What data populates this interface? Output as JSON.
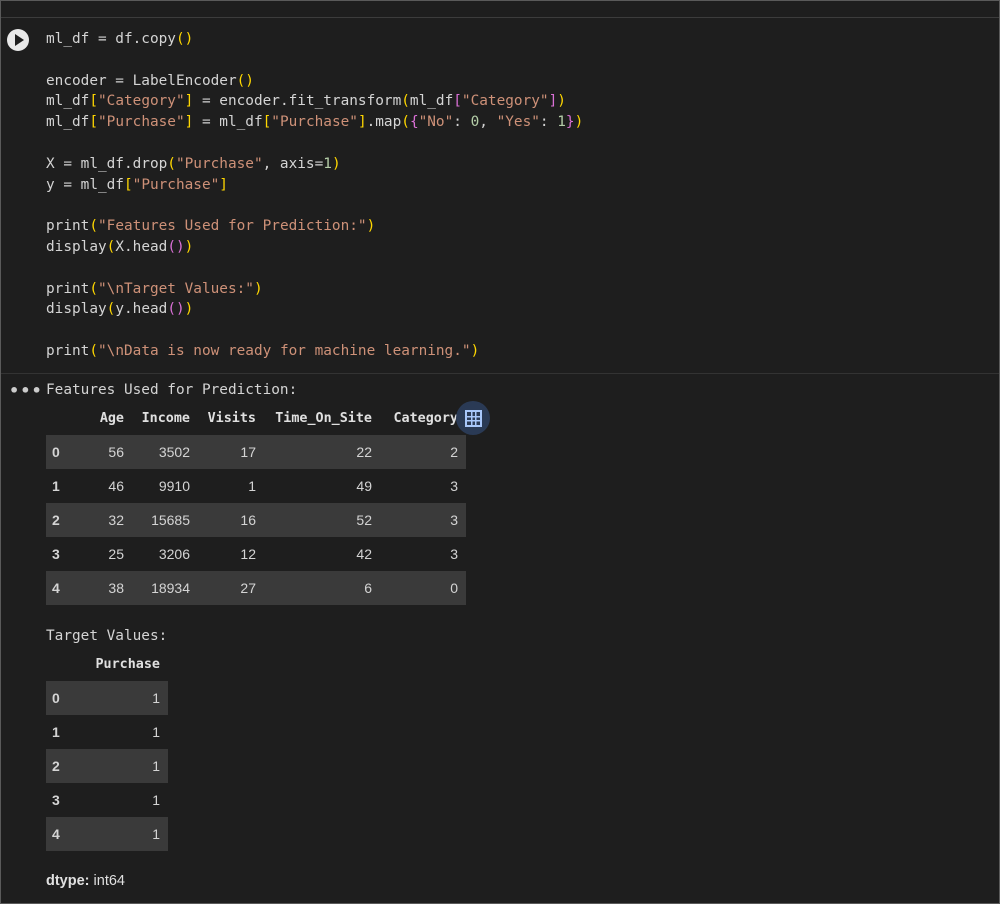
{
  "code_lines": [
    "ml_df = df.copy()",
    "",
    "encoder = LabelEncoder()",
    "ml_df[\"Category\"] = encoder.fit_transform(ml_df[\"Category\"])",
    "ml_df[\"Purchase\"] = ml_df[\"Purchase\"].map({\"No\": 0, \"Yes\": 1})",
    "",
    "X = ml_df.drop(\"Purchase\", axis=1)",
    "y = ml_df[\"Purchase\"]",
    "",
    "print(\"Features Used for Prediction:\")",
    "display(X.head())",
    "",
    "print(\"\\nTarget Values:\")",
    "display(y.head())",
    "",
    "print(\"\\nData is now ready for machine learning.\")"
  ],
  "output": {
    "menu_icon": "more-horizontal-icon",
    "features_heading": "Features Used for Prediction:",
    "features_table": {
      "columns": [
        "",
        "Age",
        "Income",
        "Visits",
        "Time_On_Site",
        "Category"
      ],
      "rows": [
        [
          "0",
          "56",
          "3502",
          "17",
          "22",
          "2"
        ],
        [
          "1",
          "46",
          "9910",
          "1",
          "49",
          "3"
        ],
        [
          "2",
          "32",
          "15685",
          "16",
          "52",
          "3"
        ],
        [
          "3",
          "25",
          "3206",
          "12",
          "42",
          "3"
        ],
        [
          "4",
          "38",
          "18934",
          "27",
          "6",
          "0"
        ]
      ]
    },
    "table_view_icon": "table-grid-icon",
    "target_heading": "Target Values:",
    "target_table": {
      "columns": [
        "",
        "Purchase"
      ],
      "rows": [
        [
          "0",
          "1"
        ],
        [
          "1",
          "1"
        ],
        [
          "2",
          "1"
        ],
        [
          "3",
          "1"
        ],
        [
          "4",
          "1"
        ]
      ]
    },
    "dtype_label": "dtype:",
    "dtype_value": "int64"
  },
  "colors": {
    "background": "#1e1e1e",
    "string": "#ce9178",
    "number": "#b5cea8",
    "bracket_level1": "#ffd700",
    "bracket_level2": "#da70d6",
    "row_stripe": "#3a3a3a"
  }
}
